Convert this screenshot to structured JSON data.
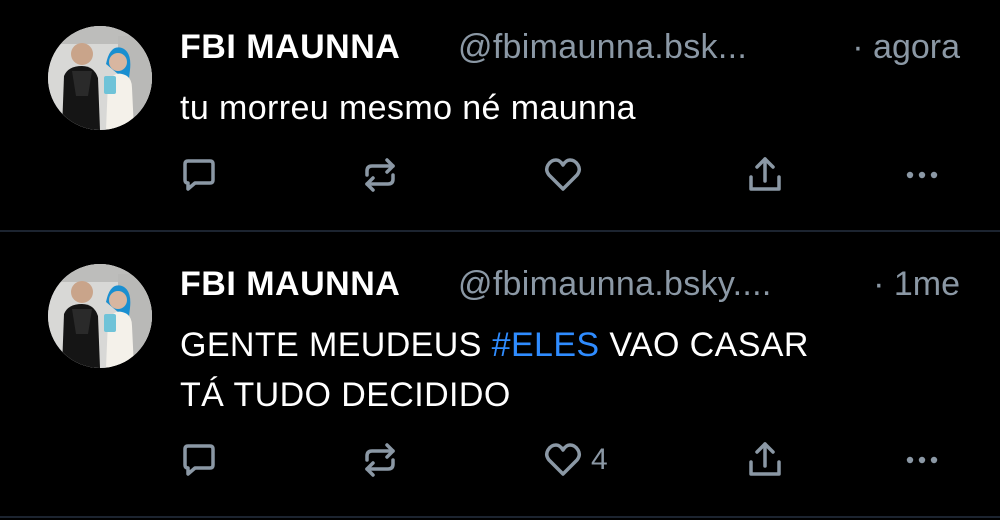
{
  "posts": [
    {
      "author_name": "FBI MAUNNA",
      "handle": "@fbimaunna.bsk...",
      "time": "· agora",
      "text_plain": "tu morreu mesmo né maunna",
      "like_count": "",
      "icons": [
        "reply-icon",
        "repost-icon",
        "like-icon",
        "share-icon",
        "more-icon"
      ]
    },
    {
      "author_name": "FBI MAUNNA",
      "handle": "@fbimaunna.bsky....",
      "time": "· 1me",
      "text_before": "GENTE MEUDEUS ",
      "hashtag": "#ELES",
      "text_after": " VAO CASAR",
      "text_line2": "TÁ TUDO DECIDIDO",
      "like_count": "4",
      "icons": [
        "reply-icon",
        "repost-icon",
        "like-icon",
        "share-icon",
        "more-icon"
      ]
    }
  ],
  "colors": {
    "background": "#000000",
    "primary_text": "#ffffff",
    "secondary_text": "#8b98a5",
    "hashtag": "#2f8cff",
    "divider": "#1c2430"
  }
}
